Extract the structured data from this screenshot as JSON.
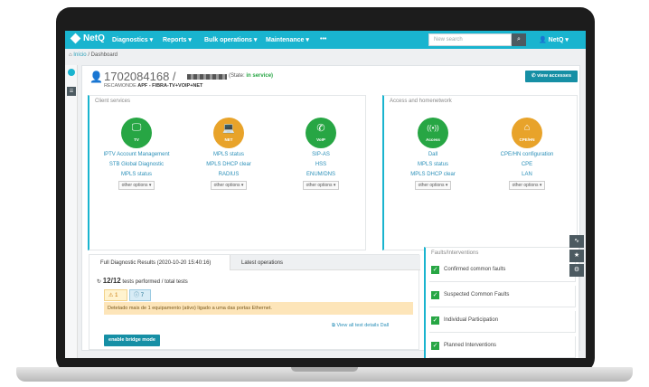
{
  "nav": {
    "brand": "NetQ",
    "items": [
      "Diagnostics ▾",
      "Reports ▾",
      "Bulk operations ▾",
      "Maintenance ▾",
      "•••"
    ],
    "search_placeholder": "New search",
    "user": "NetQ ▾"
  },
  "breadcrumb": {
    "home": "Início",
    "page": "Dashboard"
  },
  "account": {
    "id": "1702084168 /",
    "state_label": "(State:",
    "state_value": "in service)",
    "subtitle_label": "RECAMONDE",
    "subtitle_value": "APF - FIBRA-TV+VOIP+NET",
    "view_accesses": "view accesses"
  },
  "client_services": {
    "title": "Client services",
    "services": [
      {
        "icon": "tv-icon",
        "glyph": "🖵",
        "name": "TV",
        "color": "#27a644",
        "links": [
          "IPTV Account Management",
          "STB Global Diagnostic",
          "MPLS status"
        ],
        "more": "other options ▾"
      },
      {
        "icon": "laptop-icon",
        "glyph": "💻",
        "name": "NET",
        "color": "#e8a32a",
        "links": [
          "MPLS status",
          "MPLS DHCP clear",
          "RADIUS"
        ],
        "more": "other options ▾"
      },
      {
        "icon": "phone-icon",
        "glyph": "✆",
        "name": "VoIP",
        "color": "#27a644",
        "links": [
          "SIP-AS",
          "HSS",
          "ENUM/DNS"
        ],
        "more": "other options ▾"
      }
    ]
  },
  "access": {
    "title": "Access and homenetwork",
    "services": [
      {
        "icon": "antenna-icon",
        "glyph": "((•))",
        "name": "Access",
        "color": "#27a644",
        "links": [
          "Dall",
          "MPLS status",
          "MPLS DHCP clear"
        ],
        "more": "other options ▾"
      },
      {
        "icon": "home-icon",
        "glyph": "⌂",
        "name": "CPE/HN",
        "color": "#e8a32a",
        "links": [
          "CPE/HN configuration",
          "CPE",
          "LAN"
        ],
        "more": "other options ▾"
      }
    ]
  },
  "diagnostics": {
    "tab_results": "Full Diagnostic Results (2020-10-20 15:40:16)",
    "tab_latest": "Latest operations",
    "tests_count": "12/12",
    "tests_text": "tests performed / total tests",
    "warn_count": "1",
    "info_count": "7",
    "alert_text": "Detetado mais de 1 equipamento (ativo) ligado a uma das portas Ethernet.",
    "view_all": "View all test details Dall",
    "bridge_button": "enable bridge mode"
  },
  "faults": {
    "title": "Faults/Interventions",
    "items": [
      "Confirmed common faults",
      "Suspected Common Faults",
      "Individual Participation",
      "Planned Interventions"
    ]
  }
}
